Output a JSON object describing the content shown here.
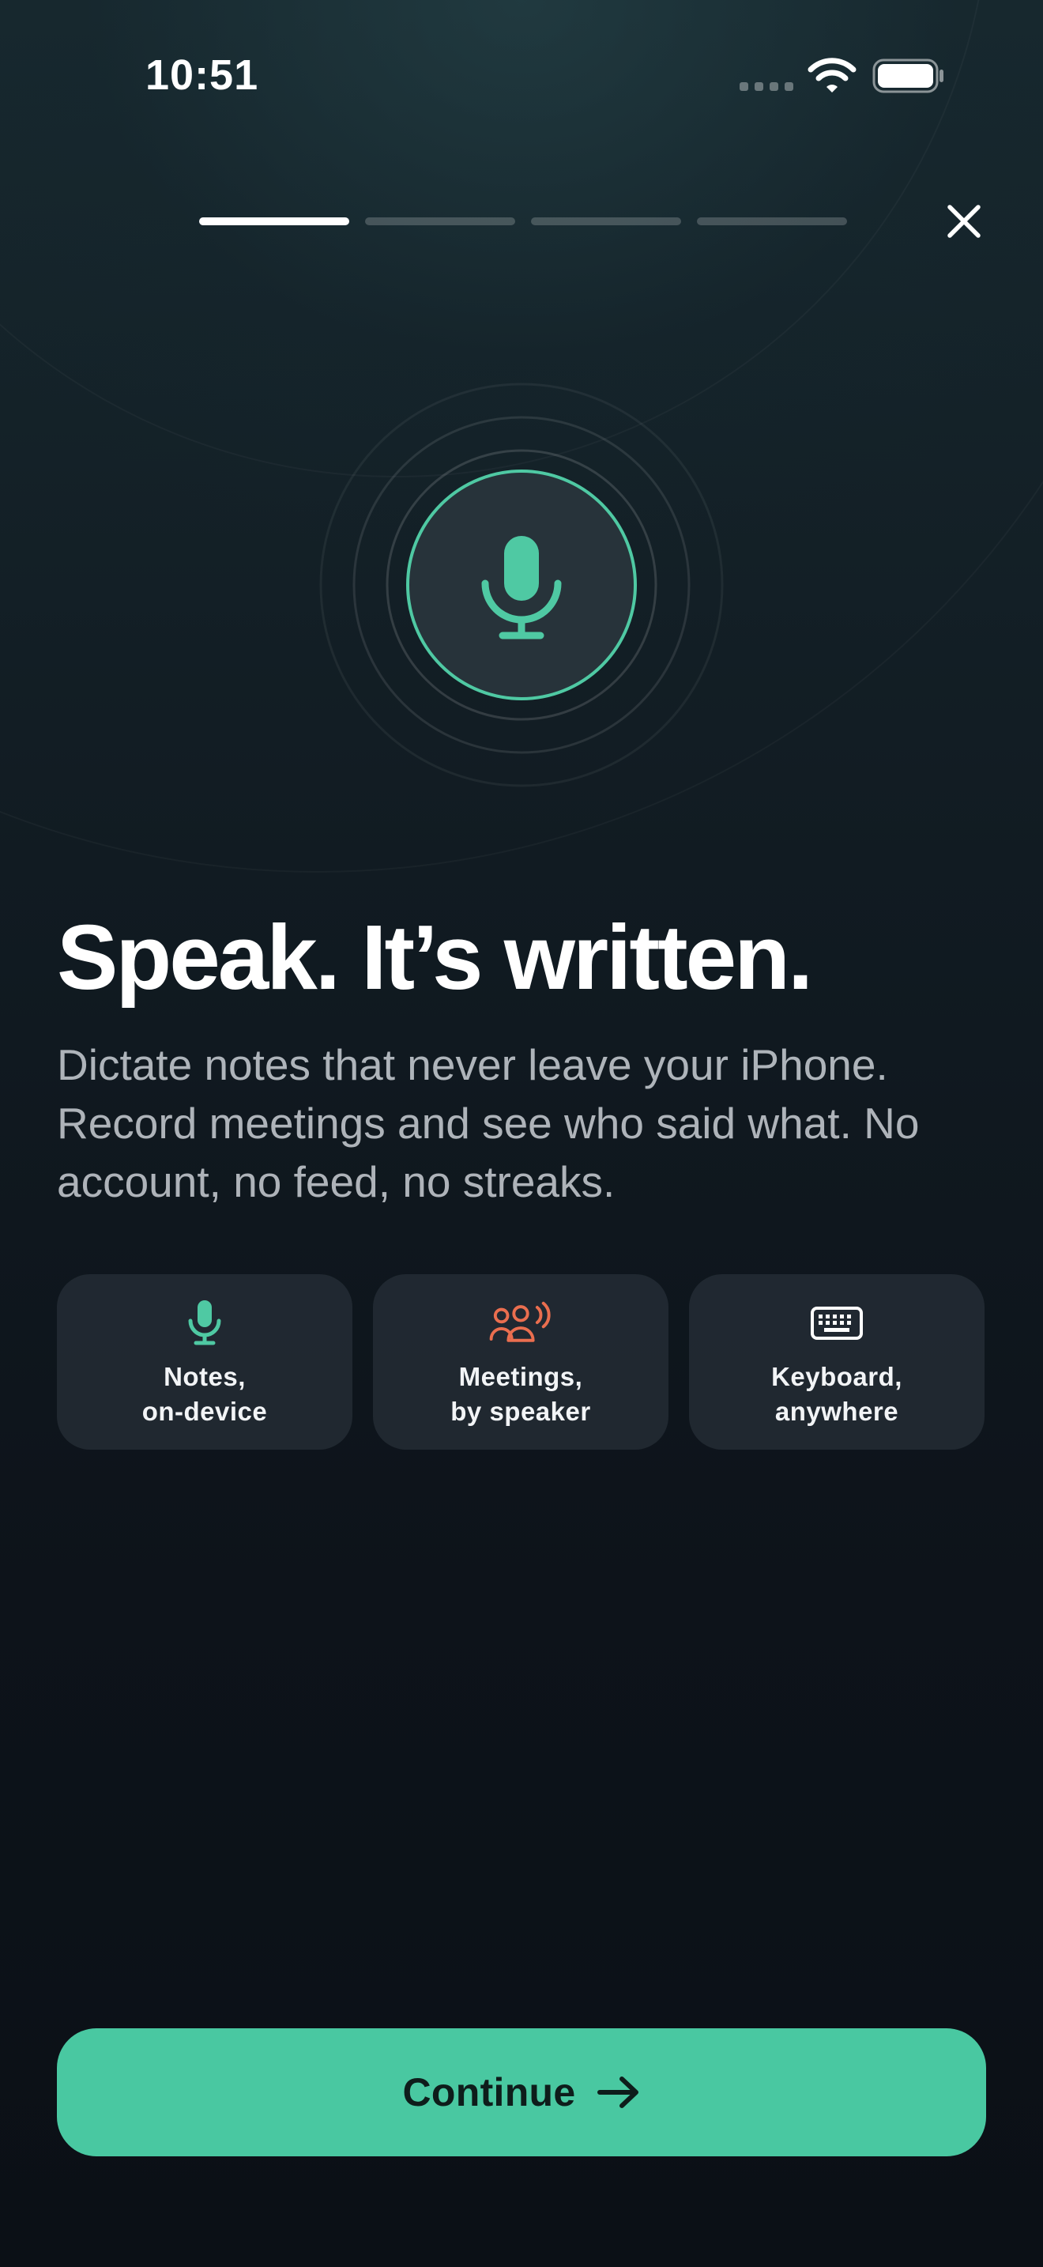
{
  "status_bar": {
    "time": "10:51"
  },
  "onboarding": {
    "progress": {
      "current_step": 1,
      "total_steps": 4
    },
    "headline": "Speak. It’s written.",
    "description": "Dictate notes that never leave your iPhone. Record meetings and see who said what. No account, no feed, no streaks.",
    "features": [
      {
        "icon": "microphone-icon",
        "label": "Notes,\non-device",
        "color": "#4fc9a3"
      },
      {
        "icon": "people-speaking-icon",
        "label": "Meetings,\nby speaker",
        "color": "#ea6e4f"
      },
      {
        "icon": "keyboard-icon",
        "label": "Keyboard,\nanywhere",
        "color": "#ffffff"
      }
    ],
    "continue_label": "Continue"
  },
  "colors": {
    "accent": "#49c8a1",
    "mic_accent": "#4fc9a3",
    "meetings_accent": "#ea6e4f",
    "background": "#0e141a"
  }
}
